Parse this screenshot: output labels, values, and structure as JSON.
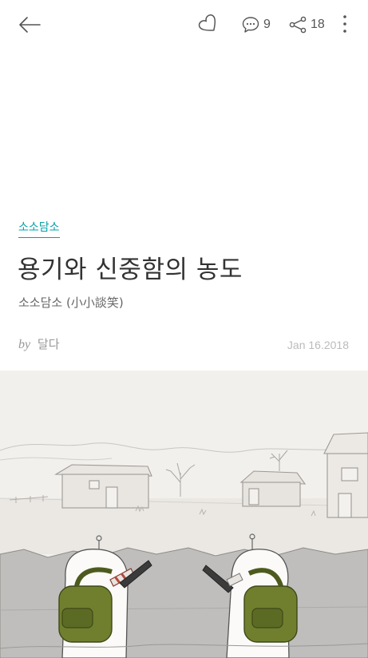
{
  "header": {
    "icons": {
      "back": "arrow-left-icon",
      "like": "heart-icon",
      "comment": "comment-bubble-icon",
      "share": "share-icon",
      "more": "more-vertical-icon"
    },
    "comment_count": "9",
    "share_count": "18"
  },
  "post": {
    "category": "소소담소",
    "title": "용기와 신중함의 농도",
    "subtitle": "소소담소 (小小談笑)",
    "by_label": "by",
    "author": "달다",
    "date": "Jan 16.2018"
  },
  "colors": {
    "accent": "#00a2a9",
    "backpack": "#6f7f2e"
  }
}
